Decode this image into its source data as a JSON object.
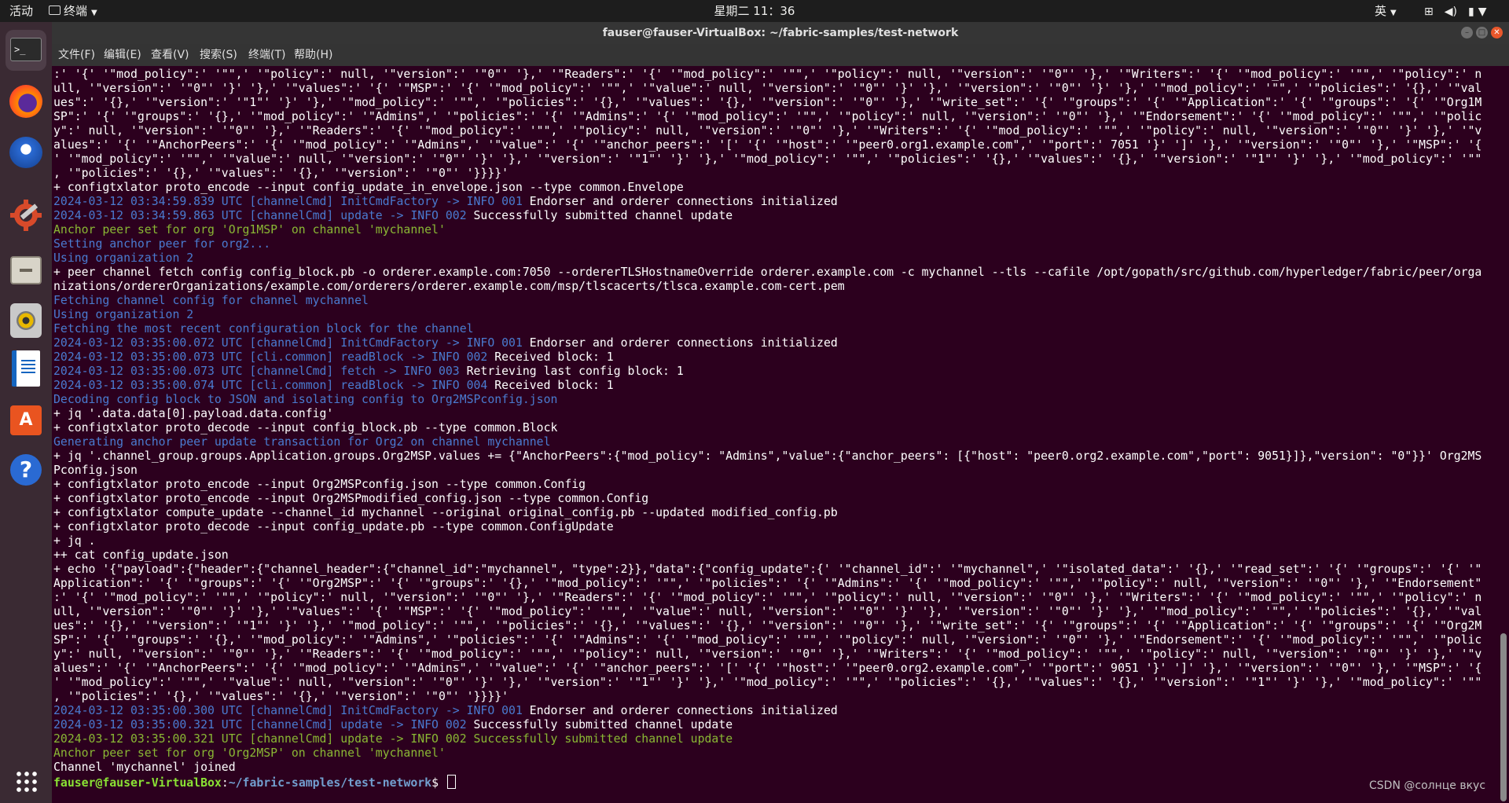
{
  "topbar": {
    "activities": "活动",
    "app_menu": "终端",
    "clock": "星期二 11：36",
    "input_method": "英"
  },
  "window": {
    "title": "fauser@fauser-VirtualBox: ~/fabric-samples/test-network"
  },
  "menu": {
    "file": "文件(F)",
    "edit": "编辑(E)",
    "view": "查看(V)",
    "search": "搜索(S)",
    "terminal": "终端(T)",
    "help": "帮助(H)"
  },
  "dock": {
    "items": [
      "Terminal",
      "Firefox",
      "Thunderbird",
      "Settings",
      "Files",
      "Rhythmbox",
      "LibreOffice Writer",
      "Ubuntu Software",
      "Help",
      "Show Applications"
    ]
  },
  "terminal": {
    "lines": [
      ":' '{' '\"mod_policy\":' '\"\",' '\"policy\":' null, '\"version\":' '\"0\"' '},' '\"Readers\":' '{' '\"mod_policy\":' '\"\",' '\"policy\":' null, '\"version\":' '\"0\"' '},' '\"Writers\":' '{' '\"mod_policy\":' '\"\",' '\"policy\":' n",
      "ull, '\"version\":' '\"0\"' '}' '},' '\"values\":' '{' '\"MSP\":' '{' '\"mod_policy\":' '\"\",' '\"value\":' null, '\"version\":' '\"0\"' '}' '},' '\"version\":' '\"0\"' '}' '},' '\"mod_policy\":' '\"\",' '\"policies\":' '{},' '\"val",
      "ues\":' '{},' '\"version\":' '\"1\"' '}' '},' '\"mod_policy\":' '\"\",' '\"policies\":' '{},' '\"values\":' '{},' '\"version\":' '\"0\"' '},' '\"write_set\":' '{' '\"groups\":' '{' '\"Application\":' '{' '\"groups\":' '{' '\"Org1M",
      "SP\":' '{' '\"groups\":' '{},' '\"mod_policy\":' '\"Admins\",' '\"policies\":' '{' '\"Admins\":' '{' '\"mod_policy\":' '\"\",' '\"policy\":' null, '\"version\":' '\"0\"' '},' '\"Endorsement\":' '{' '\"mod_policy\":' '\"\",' '\"polic",
      "y\":' null, '\"version\":' '\"0\"' '},' '\"Readers\":' '{' '\"mod_policy\":' '\"\",' '\"policy\":' null, '\"version\":' '\"0\"' '},' '\"Writers\":' '{' '\"mod_policy\":' '\"\",' '\"policy\":' null, '\"version\":' '\"0\"' '}' '},' '\"v",
      "alues\":' '{' '\"AnchorPeers\":' '{' '\"mod_policy\":' '\"Admins\",' '\"value\":' '{' '\"anchor_peers\":' '[' '{' '\"host\":' '\"peer0.org1.example.com\",' '\"port\":' 7051 '}' ']' '},' '\"version\":' '\"0\"' '},' '\"MSP\":' '{",
      "' '\"mod_policy\":' '\"\",' '\"value\":' null, '\"version\":' '\"0\"' '}' '},' '\"version\":' '\"1\"' '}' '},' '\"mod_policy\":' '\"\",' '\"policies\":' '{},' '\"values\":' '{},' '\"version\":' '\"1\"' '}' '},' '\"mod_policy\":' '\"\"",
      ", '\"policies\":' '{},' '\"values\":' '{},' '\"version\":' '\"0\"' '}}}}'",
      "+ configtxlator proto_encode --input config_update_in_envelope.json --type common.Envelope",
      "2024-03-12 03:34:59.839 UTC [channelCmd] InitCmdFactory -> INFO 001 Endorser and orderer connections initialized",
      "2024-03-12 03:34:59.863 UTC [channelCmd] update -> INFO 002 Successfully submitted channel update",
      "Anchor peer set for org 'Org1MSP' on channel 'mychannel'",
      "Setting anchor peer for org2...",
      "Using organization 2",
      "+ peer channel fetch config config_block.pb -o orderer.example.com:7050 --ordererTLSHostnameOverride orderer.example.com -c mychannel --tls --cafile /opt/gopath/src/github.com/hyperledger/fabric/peer/orga",
      "nizations/ordererOrganizations/example.com/orderers/orderer.example.com/msp/tlscacerts/tlsca.example.com-cert.pem",
      "Fetching channel config for channel mychannel",
      "Using organization 2",
      "Fetching the most recent configuration block for the channel",
      "2024-03-12 03:35:00.072 UTC [channelCmd] InitCmdFactory -> INFO 001 Endorser and orderer connections initialized",
      "2024-03-12 03:35:00.073 UTC [cli.common] readBlock -> INFO 002 Received block: 1",
      "2024-03-12 03:35:00.073 UTC [channelCmd] fetch -> INFO 003 Retrieving last config block: 1",
      "2024-03-12 03:35:00.074 UTC [cli.common] readBlock -> INFO 004 Received block: 1",
      "Decoding config block to JSON and isolating config to Org2MSPconfig.json",
      "+ jq '.data.data[0].payload.data.config'",
      "+ configtxlator proto_decode --input config_block.pb --type common.Block",
      "Generating anchor peer update transaction for Org2 on channel mychannel",
      "+ jq '.channel_group.groups.Application.groups.Org2MSP.values += {\"AnchorPeers\":{\"mod_policy\": \"Admins\",\"value\":{\"anchor_peers\": [{\"host\": \"peer0.org2.example.com\",\"port\": 9051}]},\"version\": \"0\"}}' Org2MS",
      "Pconfig.json",
      "+ configtxlator proto_encode --input Org2MSPconfig.json --type common.Config",
      "+ configtxlator proto_encode --input Org2MSPmodified_config.json --type common.Config",
      "+ configtxlator compute_update --channel_id mychannel --original original_config.pb --updated modified_config.pb",
      "+ configtxlator proto_decode --input config_update.pb --type common.ConfigUpdate",
      "+ jq .",
      "++ cat config_update.json",
      "+ echo '{\"payload\":{\"header\":{\"channel_header\":{\"channel_id\":\"mychannel\", \"type\":2}},\"data\":{\"config_update\":{' '\"channel_id\":' '\"mychannel\",' '\"isolated_data\":' '{},' '\"read_set\":' '{' '\"groups\":' '{' '\"",
      "Application\":' '{' '\"groups\":' '{' '\"Org2MSP\":' '{' '\"groups\":' '{},' '\"mod_policy\":' '\"\",' '\"policies\":' '{' '\"Admins\":' '{' '\"mod_policy\":' '\"\",' '\"policy\":' null, '\"version\":' '\"0\"' '},' '\"Endorsement\"",
      ":' '{' '\"mod_policy\":' '\"\",' '\"policy\":' null, '\"version\":' '\"0\"' '},' '\"Readers\":' '{' '\"mod_policy\":' '\"\",' '\"policy\":' null, '\"version\":' '\"0\"' '},' '\"Writers\":' '{' '\"mod_policy\":' '\"\",' '\"policy\":' n",
      "ull, '\"version\":' '\"0\"' '}' '},' '\"values\":' '{' '\"MSP\":' '{' '\"mod_policy\":' '\"\",' '\"value\":' null, '\"version\":' '\"0\"' '}' '},' '\"version\":' '\"0\"' '}' '},' '\"mod_policy\":' '\"\",' '\"policies\":' '{},' '\"val",
      "ues\":' '{},' '\"version\":' '\"1\"' '}' '},' '\"mod_policy\":' '\"\",' '\"policies\":' '{},' '\"values\":' '{},' '\"version\":' '\"0\"' '},' '\"write_set\":' '{' '\"groups\":' '{' '\"Application\":' '{' '\"groups\":' '{' '\"Org2M",
      "SP\":' '{' '\"groups\":' '{},' '\"mod_policy\":' '\"Admins\",' '\"policies\":' '{' '\"Admins\":' '{' '\"mod_policy\":' '\"\",' '\"policy\":' null, '\"version\":' '\"0\"' '},' '\"Endorsement\":' '{' '\"mod_policy\":' '\"\",' '\"polic",
      "y\":' null, '\"version\":' '\"0\"' '},' '\"Readers\":' '{' '\"mod_policy\":' '\"\",' '\"policy\":' null, '\"version\":' '\"0\"' '},' '\"Writers\":' '{' '\"mod_policy\":' '\"\",' '\"policy\":' null, '\"version\":' '\"0\"' '}' '},' '\"v",
      "alues\":' '{' '\"AnchorPeers\":' '{' '\"mod_policy\":' '\"Admins\",' '\"value\":' '{' '\"anchor_peers\":' '[' '{' '\"host\":' '\"peer0.org2.example.com\",' '\"port\":' 9051 '}' ']' '},' '\"version\":' '\"0\"' '},' '\"MSP\":' '{",
      "' '\"mod_policy\":' '\"\",' '\"value\":' null, '\"version\":' '\"0\"' '}' '},' '\"version\":' '\"1\"' '}' '},' '\"mod_policy\":' '\"\",' '\"policies\":' '{},' '\"values\":' '{},' '\"version\":' '\"1\"' '}' '},' '\"mod_policy\":' '\"\"",
      ", '\"policies\":' '{},' '\"values\":' '{},' '\"version\":' '\"0\"' '}}}}'",
      "+ configtxlator proto_encode --input config_update_in_envelope.json --type common.Envelope",
      "2024-03-12 03:35:00.300 UTC [channelCmd] InitCmdFactory -> INFO 001 Endorser and orderer connections initialized",
      "2024-03-12 03:35:00.321 UTC [channelCmd] update -> INFO 002 Successfully submitted channel update",
      "Anchor peer set for org 'Org2MSP' on channel 'mychannel'",
      "Channel 'mychannel' joined"
    ],
    "log_lines": [
      {
        "line": 9,
        "prefix": "2024-03-12 03:34:59.839 UTC [channelCmd] InitCmdFactory -> INFO 001",
        "msg": " Endorser and orderer connections initialized"
      },
      {
        "line": 10,
        "prefix": "2024-03-12 03:34:59.863 UTC [channelCmd] update -> INFO 002",
        "msg": " Successfully submitted channel update"
      },
      {
        "line": 19,
        "prefix": "2024-03-12 03:35:00.072 UTC [channelCmd] InitCmdFactory -> INFO 001",
        "msg": " Endorser and orderer connections initialized"
      },
      {
        "line": 20,
        "prefix": "2024-03-12 03:35:00.073 UTC [cli.common] readBlock -> INFO 002",
        "msg": " Received block: 1"
      },
      {
        "line": 21,
        "prefix": "2024-03-12 03:35:00.073 UTC [channelCmd] fetch -> INFO 003",
        "msg": " Retrieving last config block: 1"
      },
      {
        "line": 22,
        "prefix": "2024-03-12 03:35:00.074 UTC [cli.common] readBlock -> INFO 004",
        "msg": " Received block: 1"
      },
      {
        "line": 45,
        "prefix": "2024-03-12 03:35:00.300 UTC [channelCmd] InitCmdFactory -> INFO 001",
        "msg": " Endorser and orderer connections initialized"
      },
      {
        "line": 46,
        "prefix": "2024-03-12 03:35:00.321 UTC [channelCmd] update -> INFO 002",
        "msg": " Successfully submitted channel update"
      }
    ],
    "blue_lines": [
      12,
      13,
      16,
      17,
      18,
      23,
      26
    ],
    "yellow_lines": [
      11,
      47,
      48
    ],
    "prompt": {
      "user_host": "fauser@fauser-VirtualBox",
      "separator": ":",
      "path": "~/fabric-samples/test-network",
      "symbol": "$ "
    },
    "colors": {
      "background": "#2c001e",
      "default_text": "#ffffff",
      "log_prefix": "#4a7bd0",
      "info_message": "#4a7bd0",
      "success_message": "#8ab834",
      "prompt_user": "#8ae234",
      "prompt_path": "#729fcf"
    }
  },
  "watermark": "CSDN @солнце вкус"
}
